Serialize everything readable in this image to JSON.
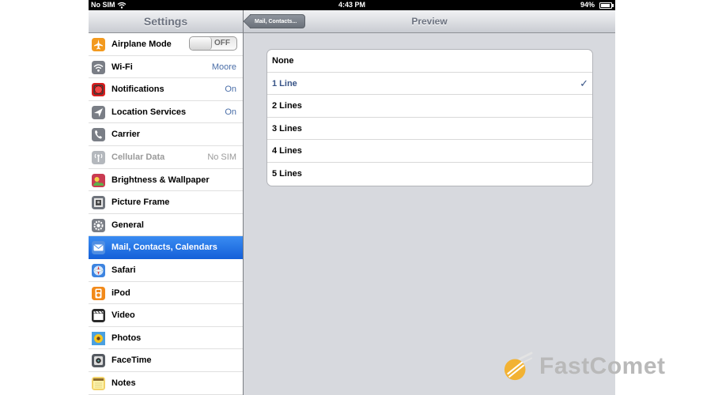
{
  "status_bar": {
    "carrier": "No SIM",
    "time": "4:43 PM",
    "battery": "94%",
    "battery_level": 0.94
  },
  "sidebar": {
    "title": "Settings",
    "items": [
      {
        "label": "Airplane Mode",
        "toggle": "OFF",
        "icon": "airplane-icon",
        "icon_color": "#f39a1e"
      },
      {
        "label": "Wi-Fi",
        "value": "Moore",
        "icon": "wifi-icon",
        "icon_color": "#7a7e86"
      },
      {
        "label": "Notifications",
        "value": "On",
        "icon": "notifications-icon",
        "icon_color": "#d81e1e"
      },
      {
        "label": "Location Services",
        "value": "On",
        "icon": "location-icon",
        "icon_color": "#7a7e86"
      },
      {
        "label": "Carrier",
        "icon": "phone-icon",
        "icon_color": "#7a7e86"
      },
      {
        "label": "Cellular Data",
        "value": "No SIM",
        "icon": "cellular-icon",
        "icon_color": "#b4b8bd",
        "disabled": true
      },
      {
        "label": "Brightness & Wallpaper",
        "icon": "brightness-icon",
        "icon_color": "#c93b52"
      },
      {
        "label": "Picture Frame",
        "icon": "picture-frame-icon",
        "icon_color": "#6f747c"
      },
      {
        "label": "General",
        "icon": "gear-icon",
        "icon_color": "#7a7e86"
      },
      {
        "label": "Mail, Contacts, Calendars",
        "icon": "mail-icon",
        "icon_color": "#4f8ee3",
        "selected": true
      },
      {
        "label": "Safari",
        "icon": "safari-icon",
        "icon_color": "#3d84e0"
      },
      {
        "label": "iPod",
        "icon": "ipod-icon",
        "icon_color": "#f28a1a"
      },
      {
        "label": "Video",
        "icon": "video-icon",
        "icon_color": "#2a2a2a"
      },
      {
        "label": "Photos",
        "icon": "photos-icon",
        "icon_color": "#f2c21a"
      },
      {
        "label": "FaceTime",
        "icon": "facetime-icon",
        "icon_color": "#555a61"
      },
      {
        "label": "Notes",
        "icon": "notes-icon",
        "icon_color": "#f2d36b"
      }
    ]
  },
  "detail": {
    "back_label": "Mail, Contacts...",
    "title": "Preview",
    "options": [
      {
        "label": "None"
      },
      {
        "label": "1 Line",
        "selected": true
      },
      {
        "label": "2 Lines"
      },
      {
        "label": "3 Lines"
      },
      {
        "label": "4 Lines"
      },
      {
        "label": "5 Lines"
      }
    ],
    "checkmark": "✓"
  },
  "watermark": {
    "text": "FastComet",
    "color": "#f2b233"
  }
}
